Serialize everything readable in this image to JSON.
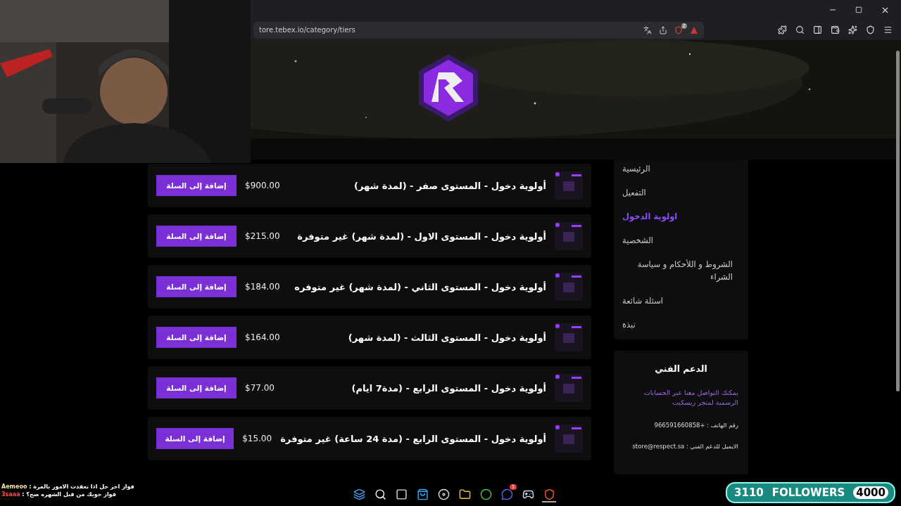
{
  "browser": {
    "address": "tore.tebex.io/category/tiers",
    "shield_badge": "2"
  },
  "products": [
    {
      "title": "أولوية دخول - المستوى صفر - (لمدة شهر)",
      "price": "$900.00",
      "button": "إضافة إلى السلة"
    },
    {
      "title": "أولوية دخول - المستوى الاول - (لمدة شهر) غير متوفرة",
      "price": "$215.00",
      "button": "إضافة إلى السلة"
    },
    {
      "title": "أولوية دخول - المستوى الثاني - (لمدة شهر) غير متوفره",
      "price": "$184.00",
      "button": "إضافة إلى السلة"
    },
    {
      "title": "أولوية دخول - المستوى الثالث - (لمدة شهر)",
      "price": "$164.00",
      "button": "إضافة إلى السلة"
    },
    {
      "title": "أولوية دخول - المستوى الرابع - (مدة7 ايام)",
      "price": "$77.00",
      "button": "إضافة إلى السلة"
    },
    {
      "title": "أولوية دخول - المستوى الرابع - (مدة 24 ساعة) غير متوفرة",
      "price": "$15.00",
      "button": "إضافة إلى السلة"
    }
  ],
  "sidebar": {
    "items": [
      {
        "label": "الرئيسية",
        "selected": false
      },
      {
        "label": "التفعيل",
        "selected": false
      },
      {
        "label": "اولوية الدخول",
        "selected": true
      },
      {
        "label": "الشخصية",
        "selected": false
      },
      {
        "label": "الشروط و اللأحكام و سياسة الشراء",
        "selected": false
      },
      {
        "label": "اسئلة شائعة",
        "selected": false
      },
      {
        "label": "نبذة",
        "selected": false
      }
    ]
  },
  "support": {
    "title": "الدعم الفني",
    "description": "يمكنك التواصل معنا عبر الحسابات الرسمية لمتجر ريسكيت",
    "phone": "رقم الهاتف : +966591660858",
    "email": "الايميل للدعم الفني : store@respect.sa"
  },
  "chat": [
    {
      "user": "Aemeoo",
      "message": ": فواز اخر حل اذا تعقدت الامور بالمرة",
      "color": "#f0e6a0"
    },
    {
      "user": "3saaa",
      "message": ": فواز خويك من قبل الشهره صح؟",
      "color": "#ff4d4d"
    }
  ],
  "followers": {
    "count": "3110",
    "label": "FOLLOWERS",
    "goal": "4000"
  },
  "taskbar": [
    {
      "kind": "start"
    },
    {
      "kind": "search"
    },
    {
      "kind": "windows"
    },
    {
      "kind": "store"
    },
    {
      "kind": "record"
    },
    {
      "kind": "folder"
    },
    {
      "kind": "chrome"
    },
    {
      "kind": "chat",
      "badge": "3"
    },
    {
      "kind": "steam"
    },
    {
      "kind": "brave",
      "selected": true
    }
  ]
}
